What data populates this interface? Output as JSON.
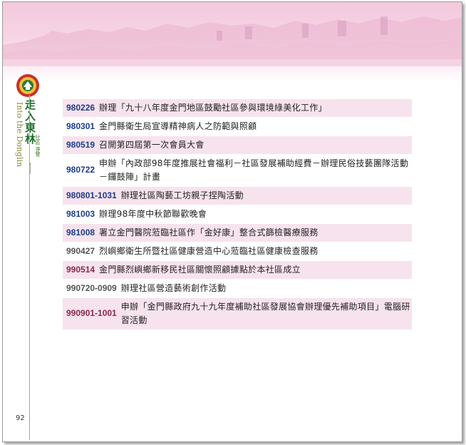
{
  "book": {
    "title": "走入東林",
    "subtitle": "Into the Donglin",
    "tags": "社區 導覽",
    "page_number": "92"
  },
  "timeline": [
    {
      "date": "980226",
      "event": "辦理「九十八年度金門地區鼓勵社區參與環境綠美化工作」"
    },
    {
      "date": "980301",
      "event": "金門縣衛生局宣導精神病人之防範與照顧"
    },
    {
      "date": "980519",
      "event": "召開第四屆第一次會員大會"
    },
    {
      "date": "980722",
      "event": "申辦「內政部98年度推展社會福利－社區發展補助經費－辦理民俗技藝團隊活動－鑼鼓陣」計畫"
    },
    {
      "date": "980801-1031",
      "event": "辦理社區陶藝工坊親子捏陶活動"
    },
    {
      "date": "981003",
      "event": "辦理98年度中秋節聯歡晚會"
    },
    {
      "date": "981008",
      "event": "署立金門醫院蒞臨社區作「金好康」整合式篩檢醫療服務"
    },
    {
      "date": "990427",
      "event": "烈嶼鄉衛生所暨社區健康營造中心蒞臨社區健康檢查服務"
    },
    {
      "date": "990514",
      "event": "金門縣烈嶼鄉新移民社區關懷照顧據點於本社區成立"
    },
    {
      "date": "990720-0909",
      "event": "辦理社區營造藝術創作活動"
    },
    {
      "date": "990901-1001",
      "event": "申辦「金門縣政府九十九年度補助社區發展協會辦理優先補助項目」電腦研習活動"
    }
  ],
  "colors": {
    "header_pink": "#f3c9dd",
    "row_pink": "#f7e3ed",
    "date_blue": "#1d3d8a",
    "date_maroon": "#8a2a4a",
    "title_green": "#1d6e2a"
  }
}
